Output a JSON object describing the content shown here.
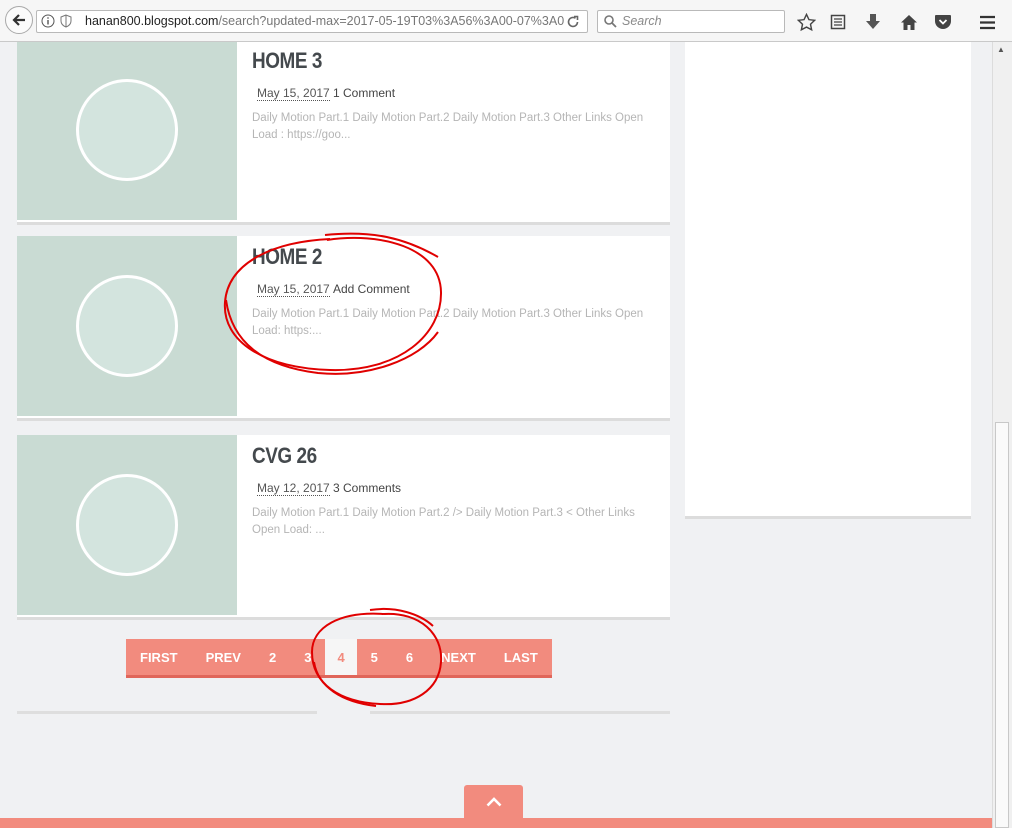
{
  "browser": {
    "url_host": "hanan800.blogspot.com",
    "url_path": "/search?updated-max=2017-05-19T03%3A56%3A00-07%3A0",
    "search_placeholder": "Search"
  },
  "posts": [
    {
      "title": "HOME 3",
      "date": "May 15, 2017",
      "comments": "1 Comment",
      "excerpt": "Daily Motion Part.1    Daily Motion Part.2 Daily Motion Part.3 Other  Links Open Load : https://goo..."
    },
    {
      "title": "HOME 2",
      "date": "May 15, 2017",
      "comments": "Add Comment",
      "excerpt": "Daily Motion Part.1    Daily Motion Part.2 Daily Motion Part.3 Other  Links Open Load: https:..."
    },
    {
      "title": "CVG 26",
      "date": "May 12, 2017",
      "comments": "3 Comments",
      "excerpt": "Daily Motion Part.1    Daily Motion Part.2 /> Daily Motion Part.3 < Other  Links Open Load: ..."
    }
  ],
  "pager": {
    "first": "FIRST",
    "prev": "PREV",
    "pages": [
      "2",
      "3",
      "4",
      "5",
      "6"
    ],
    "current": "4",
    "next": "NEXT",
    "last": "LAST"
  },
  "colors": {
    "accent": "#f28b7e",
    "thumb": "#c9dbd3",
    "annotation": "#e00000"
  },
  "icons": {
    "back": "arrow-left-icon",
    "info": "info-icon",
    "shield": "shield-icon",
    "reload": "reload-icon",
    "search": "magnifier-icon",
    "bookmark": "star-icon",
    "reading_list": "reading-list-icon",
    "download": "download-arrow-icon",
    "home": "home-icon",
    "pocket": "pocket-icon",
    "menu": "hamburger-menu-icon",
    "to_top": "chevron-up-icon"
  }
}
